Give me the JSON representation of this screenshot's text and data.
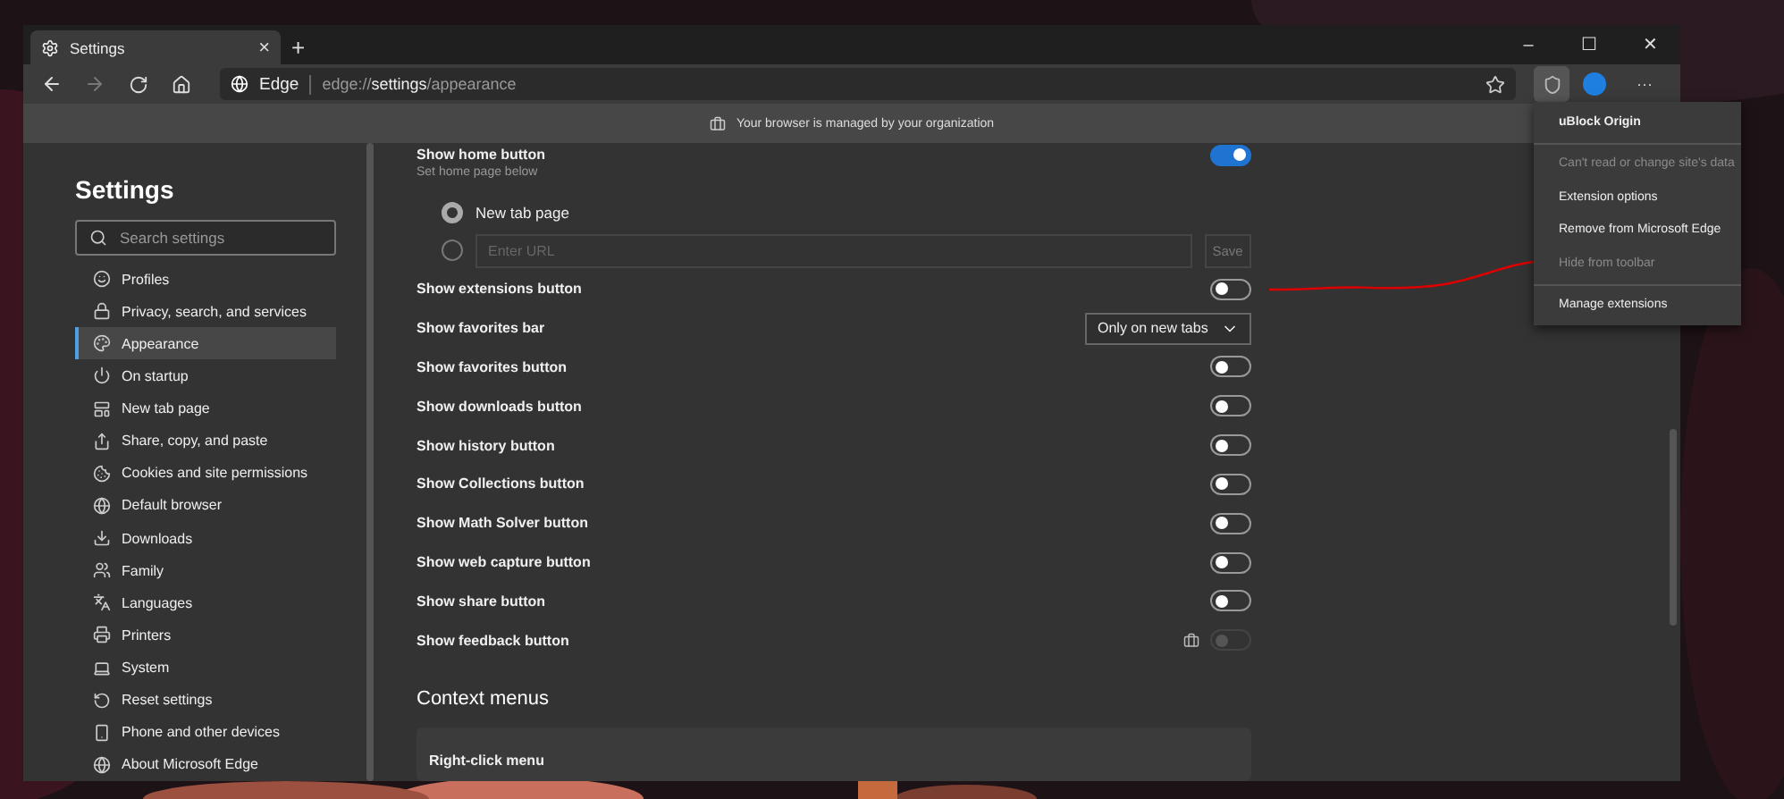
{
  "tab": {
    "title": "Settings",
    "close": "×",
    "new_tab": "+"
  },
  "window_controls": [
    "–",
    "☐",
    "✕"
  ],
  "address_bar": {
    "site": "Edge",
    "url_prefix": "edge://",
    "url_host": "settings",
    "url_path": "/appearance"
  },
  "more_button": "···",
  "info_bar": "Your browser is managed by your organization",
  "sidebar": {
    "title": "Settings",
    "search": {
      "placeholder": "Search settings"
    },
    "items": [
      {
        "label": "Profiles",
        "selected": false
      },
      {
        "label": "Privacy, search, and services",
        "selected": false
      },
      {
        "label": "Appearance",
        "selected": true
      },
      {
        "label": "On startup",
        "selected": false
      },
      {
        "label": "New tab page",
        "selected": false
      },
      {
        "label": "Share, copy, and paste",
        "selected": false
      },
      {
        "label": "Cookies and site permissions",
        "selected": false
      },
      {
        "label": "Default browser",
        "selected": false
      },
      {
        "label": "Downloads",
        "selected": false
      },
      {
        "label": "Family",
        "selected": false
      },
      {
        "label": "Languages",
        "selected": false
      },
      {
        "label": "Printers",
        "selected": false
      },
      {
        "label": "System",
        "selected": false
      },
      {
        "label": "Reset settings",
        "selected": false
      },
      {
        "label": "Phone and other devices",
        "selected": false
      },
      {
        "label": "About Microsoft Edge",
        "selected": false
      }
    ]
  },
  "home": {
    "label": "Show home button",
    "on": true,
    "hint": "Set home page below",
    "options": [
      {
        "label": "New tab page",
        "selected": true
      }
    ],
    "url_option": {
      "selected": false,
      "placeholder": "Enter URL",
      "save": "Save"
    }
  },
  "settings": [
    {
      "kind": "toggle",
      "label": "Show extensions button",
      "on": false,
      "disabled": false
    },
    {
      "kind": "dropdown",
      "label": "Show favorites bar",
      "value": "Only on new tabs"
    },
    {
      "kind": "toggle",
      "label": "Show favorites button",
      "on": false,
      "disabled": false
    },
    {
      "kind": "toggle",
      "label": "Show downloads button",
      "on": false,
      "disabled": false
    },
    {
      "kind": "toggle",
      "label": "Show history button",
      "on": false,
      "disabled": false
    },
    {
      "kind": "toggle",
      "label": "Show Collections button",
      "on": false,
      "disabled": false
    },
    {
      "kind": "toggle",
      "label": "Show Math Solver button",
      "on": false,
      "disabled": false
    },
    {
      "kind": "toggle",
      "label": "Show web capture button",
      "on": false,
      "disabled": false
    },
    {
      "kind": "toggle",
      "label": "Show share button",
      "on": false,
      "disabled": false
    },
    {
      "kind": "toggle",
      "label": "Show feedback button",
      "on": false,
      "disabled": true,
      "managed": true
    }
  ],
  "context_menus": {
    "heading": "Context menus",
    "card_title": "Right-click menu"
  },
  "extension_menu": {
    "items": [
      {
        "label": "uBlock Origin",
        "kind": "header",
        "disabled": false
      },
      {
        "label": "Can't read or change site's data",
        "kind": "item",
        "disabled": true,
        "separator_before": true
      },
      {
        "label": "Extension options",
        "kind": "item",
        "disabled": false
      },
      {
        "label": "Remove from Microsoft Edge",
        "kind": "item",
        "disabled": false
      },
      {
        "label": "Hide from toolbar",
        "kind": "item",
        "disabled": true
      },
      {
        "label": "Manage extensions",
        "kind": "item",
        "disabled": false,
        "separator_before": true
      }
    ]
  }
}
